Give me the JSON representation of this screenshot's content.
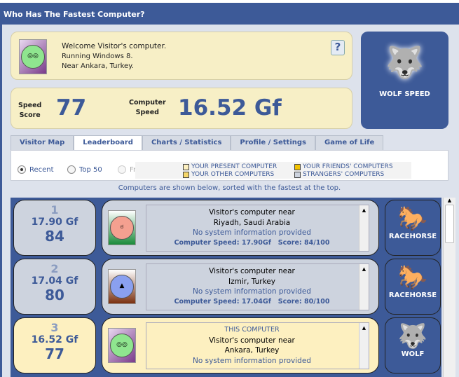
{
  "title": "Who Has The Fastest Computer?",
  "welcome": {
    "line1": "Welcome Visitor's computer.",
    "line2": "Running Windows 8.",
    "line3": "Near Ankara, Turkey.",
    "help": "?"
  },
  "speed": {
    "score_label_1": "Speed",
    "score_label_2": "Score",
    "score": "77",
    "comp_label_1": "Computer",
    "comp_label_2": "Speed",
    "comp_speed": "16.52 Gf"
  },
  "badge": {
    "label": "WOLF SPEED"
  },
  "tabs": [
    "Visitor Map",
    "Leaderboard",
    "Charts / Statistics",
    "Profile / Settings",
    "Game of Life"
  ],
  "filters": {
    "recent": "Recent",
    "top50": "Top 50",
    "friends": "Friends"
  },
  "legend": {
    "present": "YOUR PRESENT COMPUTER",
    "other": "YOUR OTHER COMPUTERS",
    "friends": "YOUR FRIENDS' COMPUTERS",
    "strangers": "STRANGERS' COMPUTERS",
    "colors": {
      "present": "#fdf0c0",
      "other": "#f5d66a",
      "friends": "#f2c200",
      "strangers": "#cdd3de"
    }
  },
  "message": "Computers are shown below, sorted with the fastest at the top.",
  "rows": [
    {
      "rank": "1",
      "gf": "17.90 Gf",
      "score": "84",
      "tag": "",
      "line1": "Visitor's computer near",
      "line2": "Riyadh, Saudi Arabia",
      "line3": "No system information provided",
      "speed": "Computer Speed: 17.90Gf",
      "score_text": "Score: 84/100",
      "animal": "RACEHORSE"
    },
    {
      "rank": "2",
      "gf": "17.04 Gf",
      "score": "80",
      "tag": "",
      "line1": "Visitor's computer near",
      "line2": "Izmir, Turkey",
      "line3": "No system information provided",
      "speed": "Computer Speed: 17.04Gf",
      "score_text": "Score: 80/100",
      "animal": "RACEHORSE"
    },
    {
      "rank": "3",
      "gf": "16.52 Gf",
      "score": "77",
      "tag": "THIS COMPUTER",
      "line1": "Visitor's computer near",
      "line2": "Ankara, Turkey",
      "line3": "No system information provided",
      "speed": "",
      "score_text": "",
      "animal": "WOLF"
    }
  ]
}
